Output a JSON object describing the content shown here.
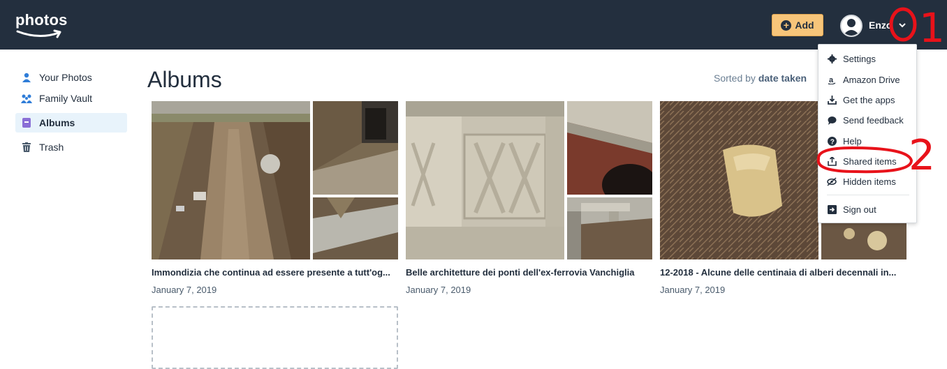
{
  "header": {
    "logo_text": "photos",
    "add_label": "Add",
    "user_name": "Enzo"
  },
  "sidebar": {
    "items": [
      {
        "label": "Your Photos",
        "icon": "person-icon"
      },
      {
        "label": "Family Vault",
        "icon": "family-icon"
      },
      {
        "label": "Albums",
        "icon": "album-icon",
        "active": true
      },
      {
        "label": "Trash",
        "icon": "trash-icon"
      }
    ]
  },
  "main": {
    "title": "Albums",
    "sort_prefix": "Sorted by",
    "sort_value": "date taken"
  },
  "albums": [
    {
      "title": "Immondizia che continua ad essere presente a tutt'og...",
      "date": "January 7, 2019"
    },
    {
      "title": "Belle architetture dei ponti dell'ex-ferrovia Vanchiglia",
      "date": "January 7, 2019"
    },
    {
      "title": "12-2018 - Alcune delle centinaia di alberi decennali in...",
      "date": "January 7, 2019"
    }
  ],
  "menu": {
    "items": [
      {
        "label": "Settings",
        "icon": "gear-icon"
      },
      {
        "label": "Amazon Drive",
        "icon": "amazon-drive-icon"
      },
      {
        "label": "Get the apps",
        "icon": "download-icon"
      },
      {
        "label": "Send feedback",
        "icon": "chat-bubble-icon"
      },
      {
        "label": "Help",
        "icon": "help-icon"
      },
      {
        "label": "Shared items",
        "icon": "share-icon"
      },
      {
        "label": "Hidden items",
        "icon": "eye-slash-icon"
      },
      {
        "label": "Sign out",
        "icon": "sign-out-icon"
      }
    ]
  },
  "annotations": {
    "mark_1": "1",
    "mark_2": "2",
    "color": "#e8121a"
  },
  "colors": {
    "header_bg": "#232f3e",
    "add_button": "#f7c57a",
    "active_nav_bg": "#e8f3fb",
    "annotation_red": "#e8121a"
  }
}
